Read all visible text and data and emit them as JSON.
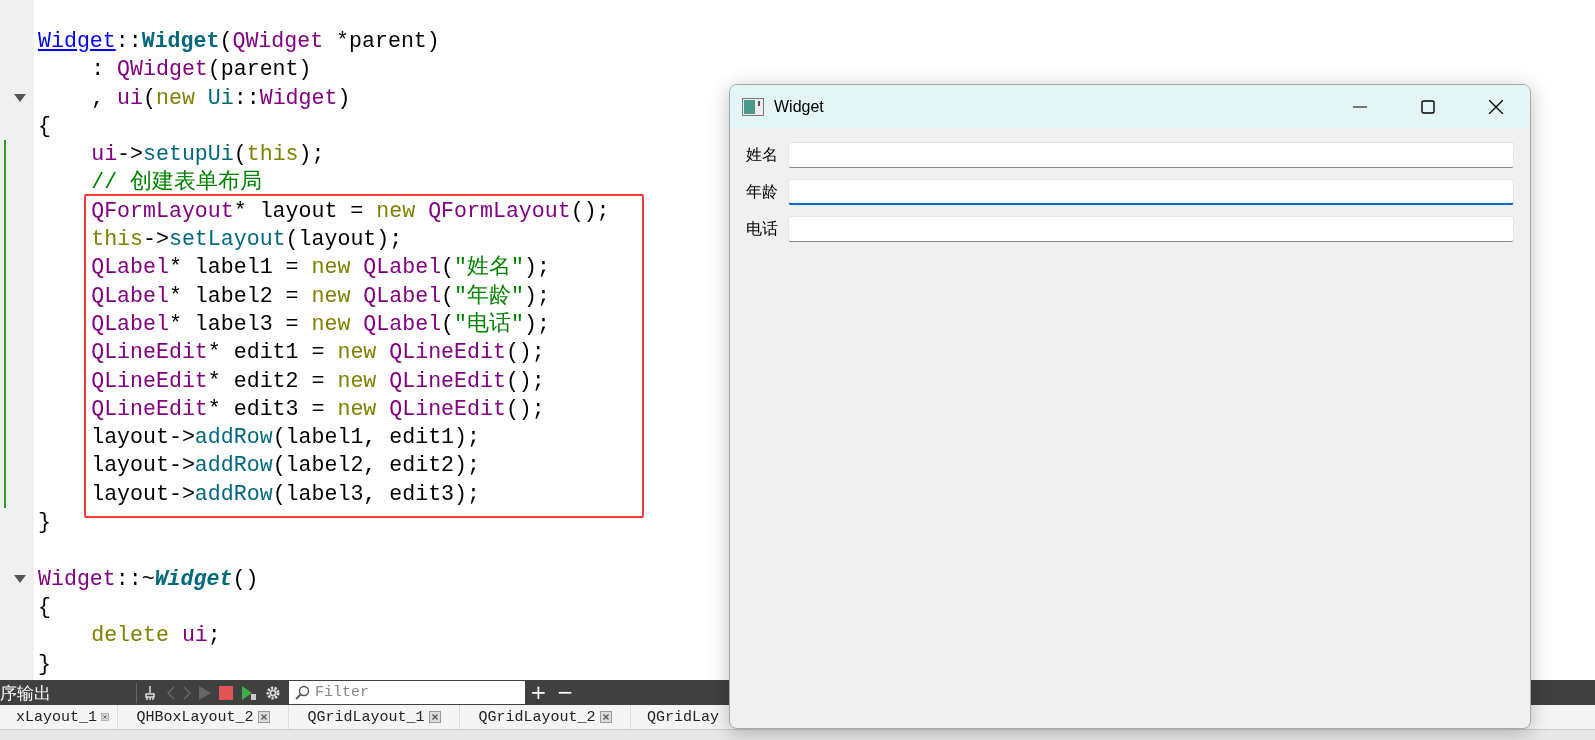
{
  "editor": {
    "lines": [
      {
        "kind": "line",
        "fold": false,
        "changed": false,
        "tokens": [
          {
            "text": "Widget",
            "kind": "link"
          },
          {
            "text": "::",
            "kind": "plain"
          },
          {
            "text": "Widget",
            "kind": "defn"
          },
          {
            "text": "(",
            "kind": "plain"
          },
          {
            "text": "QWidget",
            "kind": "type"
          },
          {
            "text": " *parent)",
            "kind": "plain"
          }
        ],
        "children": [
          {
            "kind": "line",
            "fold": false,
            "changed": false,
            "tokens": [
              {
                "text": ": ",
                "kind": "plain"
              },
              {
                "text": "QWidget",
                "kind": "type"
              },
              {
                "text": "(parent)",
                "kind": "plain"
              }
            ]
          },
          {
            "kind": "line",
            "fold": true,
            "changed": false,
            "tokens": [
              {
                "text": ", ",
                "kind": "plain"
              },
              {
                "text": "ui",
                "kind": "member"
              },
              {
                "text": "(",
                "kind": "plain"
              },
              {
                "text": "new ",
                "kind": "keyword"
              },
              {
                "text": "Ui",
                "kind": "namespace"
              },
              {
                "text": "::",
                "kind": "plain"
              },
              {
                "text": "Widget",
                "kind": "type"
              },
              {
                "text": ")",
                "kind": "plain"
              }
            ]
          }
        ]
      },
      {
        "kind": "line",
        "fold": false,
        "changed": false,
        "tokens": [
          {
            "text": "{",
            "kind": "plain"
          }
        ],
        "children": [
          {
            "kind": "line",
            "fold": false,
            "changed": true,
            "tokens": [
              {
                "text": "ui",
                "kind": "member"
              },
              {
                "text": "->",
                "kind": "plain"
              },
              {
                "text": "setupUi",
                "kind": "func"
              },
              {
                "text": "(",
                "kind": "plain"
              },
              {
                "text": "this",
                "kind": "keyword"
              },
              {
                "text": ");",
                "kind": "plain"
              }
            ]
          },
          {
            "kind": "line",
            "fold": false,
            "changed": true,
            "tokens": [
              {
                "text": "// 创建表单布局",
                "kind": "comment"
              }
            ]
          },
          {
            "kind": "frame",
            "children": [
              {
                "kind": "line",
                "fold": false,
                "changed": true,
                "tokens": [
                  {
                    "text": "QFormLayout",
                    "kind": "type"
                  },
                  {
                    "text": "* layout = ",
                    "kind": "plain"
                  },
                  {
                    "text": "new ",
                    "kind": "keyword"
                  },
                  {
                    "text": "QFormLayout",
                    "kind": "type"
                  },
                  {
                    "text": "();",
                    "kind": "plain"
                  }
                ]
              },
              {
                "kind": "line",
                "fold": false,
                "changed": true,
                "tokens": [
                  {
                    "text": "this",
                    "kind": "keyword"
                  },
                  {
                    "text": "->",
                    "kind": "plain"
                  },
                  {
                    "text": "setLayout",
                    "kind": "func"
                  },
                  {
                    "text": "(layout);",
                    "kind": "plain"
                  }
                ]
              },
              {
                "kind": "line",
                "fold": false,
                "changed": true,
                "tokens": [
                  {
                    "text": "QLabel",
                    "kind": "type"
                  },
                  {
                    "text": "* label1 = ",
                    "kind": "plain"
                  },
                  {
                    "text": "new ",
                    "kind": "keyword"
                  },
                  {
                    "text": "QLabel",
                    "kind": "type"
                  },
                  {
                    "text": "(",
                    "kind": "plain"
                  },
                  {
                    "text": "\"姓名\"",
                    "kind": "string"
                  },
                  {
                    "text": ");",
                    "kind": "plain"
                  }
                ]
              },
              {
                "kind": "line",
                "fold": false,
                "changed": true,
                "tokens": [
                  {
                    "text": "QLabel",
                    "kind": "type"
                  },
                  {
                    "text": "* label2 = ",
                    "kind": "plain"
                  },
                  {
                    "text": "new ",
                    "kind": "keyword"
                  },
                  {
                    "text": "QLabel",
                    "kind": "type"
                  },
                  {
                    "text": "(",
                    "kind": "plain"
                  },
                  {
                    "text": "\"年龄\"",
                    "kind": "string"
                  },
                  {
                    "text": ");",
                    "kind": "plain"
                  }
                ]
              },
              {
                "kind": "line",
                "fold": false,
                "changed": true,
                "tokens": [
                  {
                    "text": "QLabel",
                    "kind": "type"
                  },
                  {
                    "text": "* label3 = ",
                    "kind": "plain"
                  },
                  {
                    "text": "new ",
                    "kind": "keyword"
                  },
                  {
                    "text": "QLabel",
                    "kind": "type"
                  },
                  {
                    "text": "(",
                    "kind": "plain"
                  },
                  {
                    "text": "\"电话\"",
                    "kind": "string"
                  },
                  {
                    "text": ");",
                    "kind": "plain"
                  }
                ]
              },
              {
                "kind": "line",
                "fold": false,
                "changed": true,
                "tokens": [
                  {
                    "text": "QLineEdit",
                    "kind": "type"
                  },
                  {
                    "text": "* edit1 = ",
                    "kind": "plain"
                  },
                  {
                    "text": "new ",
                    "kind": "keyword"
                  },
                  {
                    "text": "QLineEdit",
                    "kind": "type"
                  },
                  {
                    "text": "();",
                    "kind": "plain"
                  }
                ]
              },
              {
                "kind": "line",
                "fold": false,
                "changed": true,
                "tokens": [
                  {
                    "text": "QLineEdit",
                    "kind": "type"
                  },
                  {
                    "text": "* edit2 = ",
                    "kind": "plain"
                  },
                  {
                    "text": "new ",
                    "kind": "keyword"
                  },
                  {
                    "text": "QLineEdit",
                    "kind": "type"
                  },
                  {
                    "text": "();",
                    "kind": "plain"
                  }
                ]
              },
              {
                "kind": "line",
                "fold": false,
                "changed": true,
                "tokens": [
                  {
                    "text": "QLineEdit",
                    "kind": "type"
                  },
                  {
                    "text": "* edit3 = ",
                    "kind": "plain"
                  },
                  {
                    "text": "new ",
                    "kind": "keyword"
                  },
                  {
                    "text": "QLineEdit",
                    "kind": "type"
                  },
                  {
                    "text": "();",
                    "kind": "plain"
                  }
                ]
              },
              {
                "kind": "line",
                "fold": false,
                "changed": true,
                "tokens": [
                  {
                    "text": "layout->",
                    "kind": "plain"
                  },
                  {
                    "text": "addRow",
                    "kind": "func"
                  },
                  {
                    "text": "(label1, edit1);",
                    "kind": "plain"
                  }
                ]
              },
              {
                "kind": "line",
                "fold": false,
                "changed": true,
                "tokens": [
                  {
                    "text": "layout->",
                    "kind": "plain"
                  },
                  {
                    "text": "addRow",
                    "kind": "func"
                  },
                  {
                    "text": "(label2, edit2);",
                    "kind": "plain"
                  }
                ]
              },
              {
                "kind": "line",
                "fold": false,
                "changed": true,
                "tokens": [
                  {
                    "text": "layout->",
                    "kind": "plain"
                  },
                  {
                    "text": "addRow",
                    "kind": "func"
                  },
                  {
                    "text": "(label3, edit3);",
                    "kind": "plain"
                  }
                ]
              }
            ]
          }
        ]
      },
      {
        "kind": "line",
        "fold": false,
        "changed": false,
        "tokens": [
          {
            "text": "}",
            "kind": "plain"
          }
        ]
      },
      {
        "kind": "blank"
      },
      {
        "kind": "line",
        "fold": true,
        "changed": false,
        "tokens": [
          {
            "text": "Widget",
            "kind": "type"
          },
          {
            "text": "::~",
            "kind": "plain"
          },
          {
            "text": "Widget",
            "kind": "defn-italic"
          },
          {
            "text": "()",
            "kind": "plain"
          }
        ]
      },
      {
        "kind": "line",
        "fold": false,
        "changed": false,
        "tokens": [
          {
            "text": "{",
            "kind": "plain"
          }
        ],
        "children": [
          {
            "kind": "line",
            "fold": false,
            "changed": false,
            "tokens": [
              {
                "text": "delete ",
                "kind": "keyword"
              },
              {
                "text": "ui",
                "kind": "member"
              },
              {
                "text": ";",
                "kind": "plain"
              }
            ]
          }
        ]
      },
      {
        "kind": "line",
        "fold": false,
        "changed": false,
        "tokens": [
          {
            "text": "}",
            "kind": "plain"
          }
        ]
      }
    ]
  },
  "output_panel": {
    "title": "序输出",
    "toolbar": [
      {
        "kind": "clear",
        "disabled": false
      },
      {
        "kind": "prev",
        "disabled": true
      },
      {
        "kind": "next",
        "disabled": true
      },
      {
        "kind": "run",
        "disabled": true
      },
      {
        "kind": "stop",
        "disabled": false
      },
      {
        "kind": "debug",
        "disabled": false
      },
      {
        "kind": "settings",
        "disabled": false
      }
    ],
    "filter": {
      "placeholder": "Filter"
    },
    "actions": [
      "+",
      "−"
    ],
    "tabs": [
      {
        "label": "xLayout_1",
        "selected": false
      },
      {
        "label": "QHBoxLayout_2",
        "selected": false
      },
      {
        "label": "QGridLayout_1",
        "selected": false
      },
      {
        "label": "QGridLayout_2",
        "selected": false
      },
      {
        "label": "QGridLay",
        "selected": false
      }
    ]
  },
  "window": {
    "title": "Widget",
    "fields": [
      {
        "label": "姓名",
        "focused": false
      },
      {
        "label": "年龄",
        "focused": true
      },
      {
        "label": "电话",
        "focused": false
      }
    ]
  }
}
